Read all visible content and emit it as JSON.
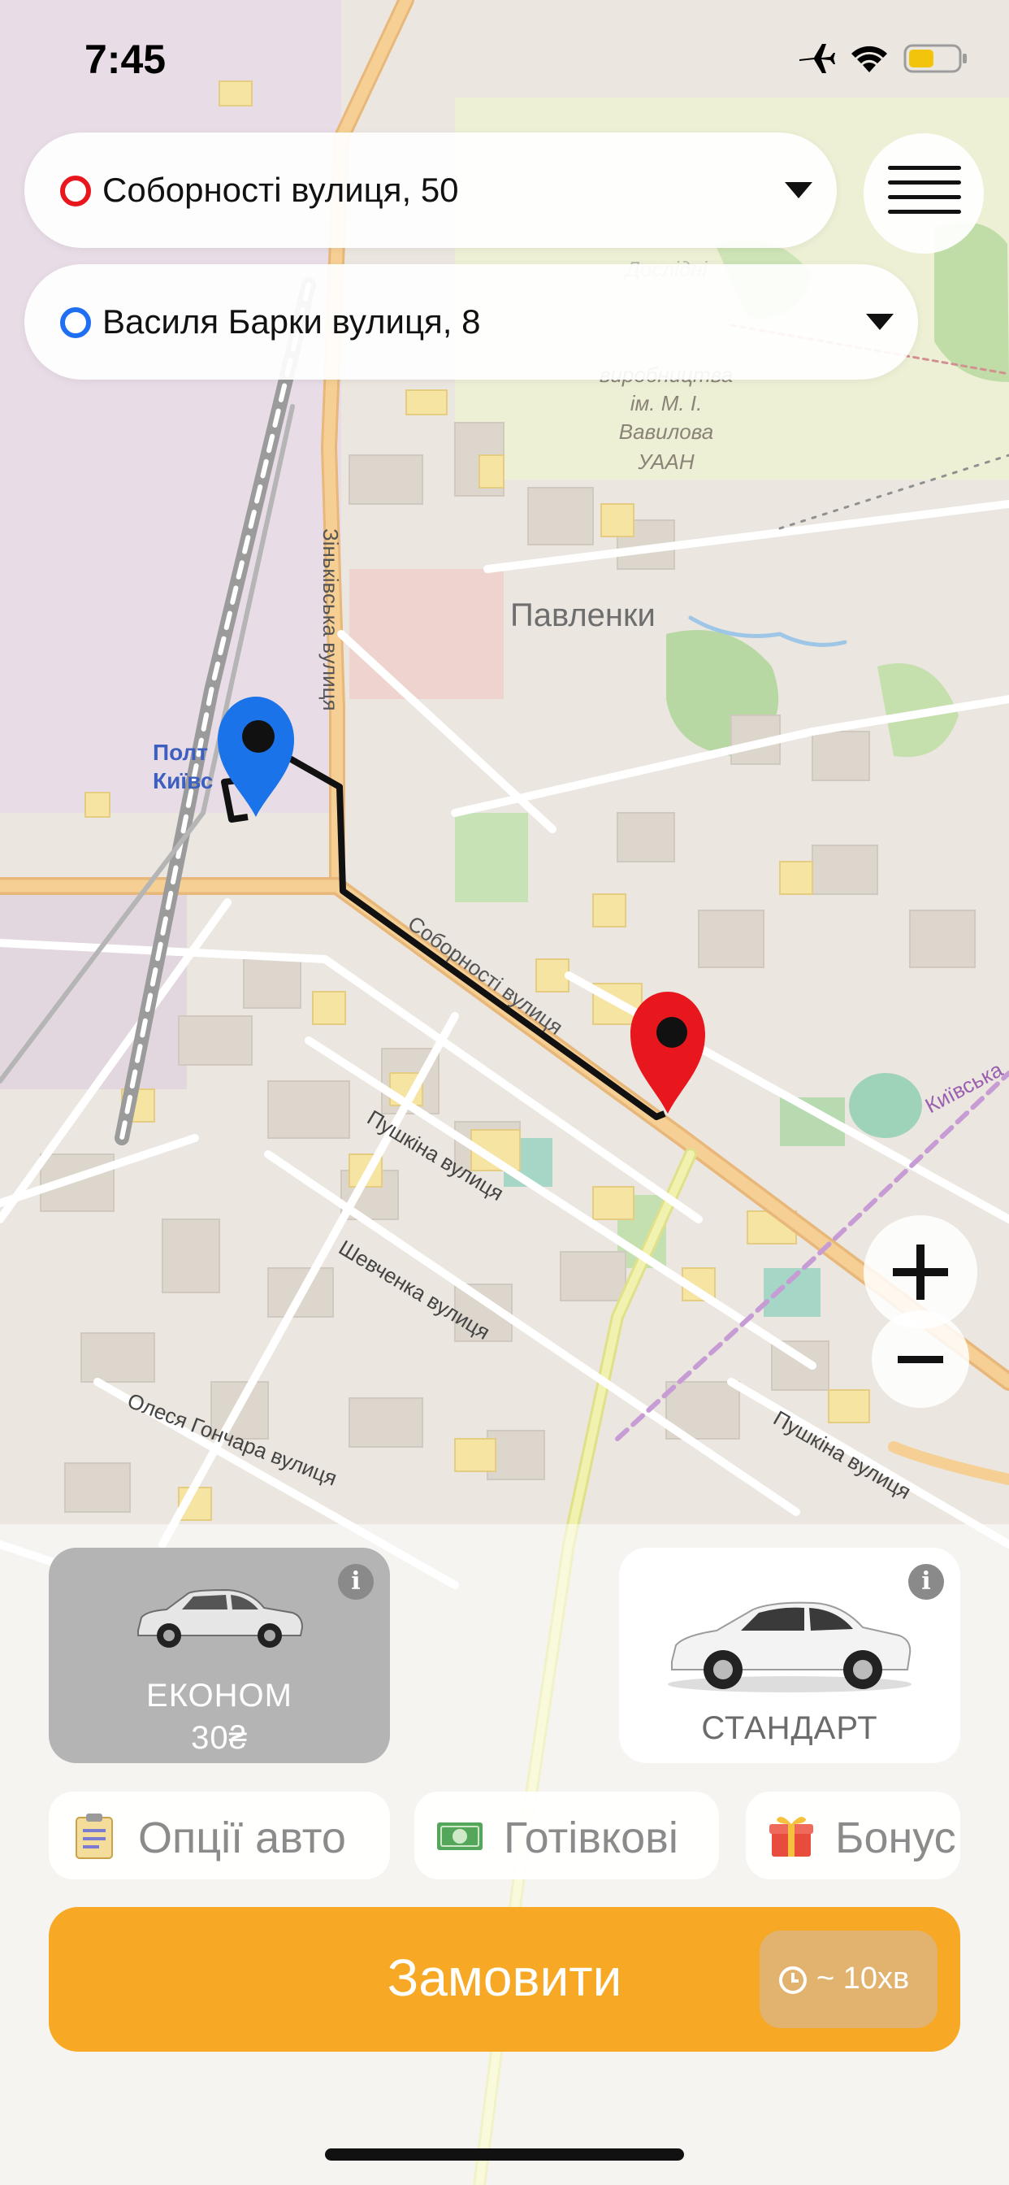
{
  "status_bar": {
    "time": "7:45"
  },
  "route": {
    "from": {
      "address": "Соборності вулиця, 50",
      "color": "#e8171d"
    },
    "to": {
      "address": "Василя Барки вулиця, 8",
      "color": "#1f6ff2"
    }
  },
  "map": {
    "labels": {
      "field_research": "Дослідні поля Полтовського інституту агропромислового виробництва ім. М. І. Вавилова УААН",
      "pavlenky": "Павленки",
      "zinkivska": "Зіньківська вулиця",
      "sobornosti": "Соборності вулиця",
      "pushkina1": "Пушкіна вулиця",
      "shevchenka": "Шевченка вулиця",
      "olesia": "Олеся Гончара вулиця",
      "pushkina2": "Пушкіна вулиця",
      "kyivska": "Київська",
      "station": "Полтава Київська"
    },
    "colors": {
      "route": "#111111",
      "pin_start": "#1a73e8",
      "pin_end": "#e8171d"
    }
  },
  "tariffs": [
    {
      "name": "ЕКОНОМ",
      "price": "30₴",
      "selected": true
    },
    {
      "name": "СТАНДАРТ",
      "price": "",
      "selected": false
    }
  ],
  "options": [
    {
      "label": "Опції авто",
      "icon": "clipboard-icon"
    },
    {
      "label": "Готівкові",
      "icon": "cash-icon"
    },
    {
      "label": "Бонус",
      "icon": "gift-icon"
    }
  ],
  "order": {
    "label": "Замовити",
    "eta": "~ 10хв",
    "color": "#f7a824"
  }
}
